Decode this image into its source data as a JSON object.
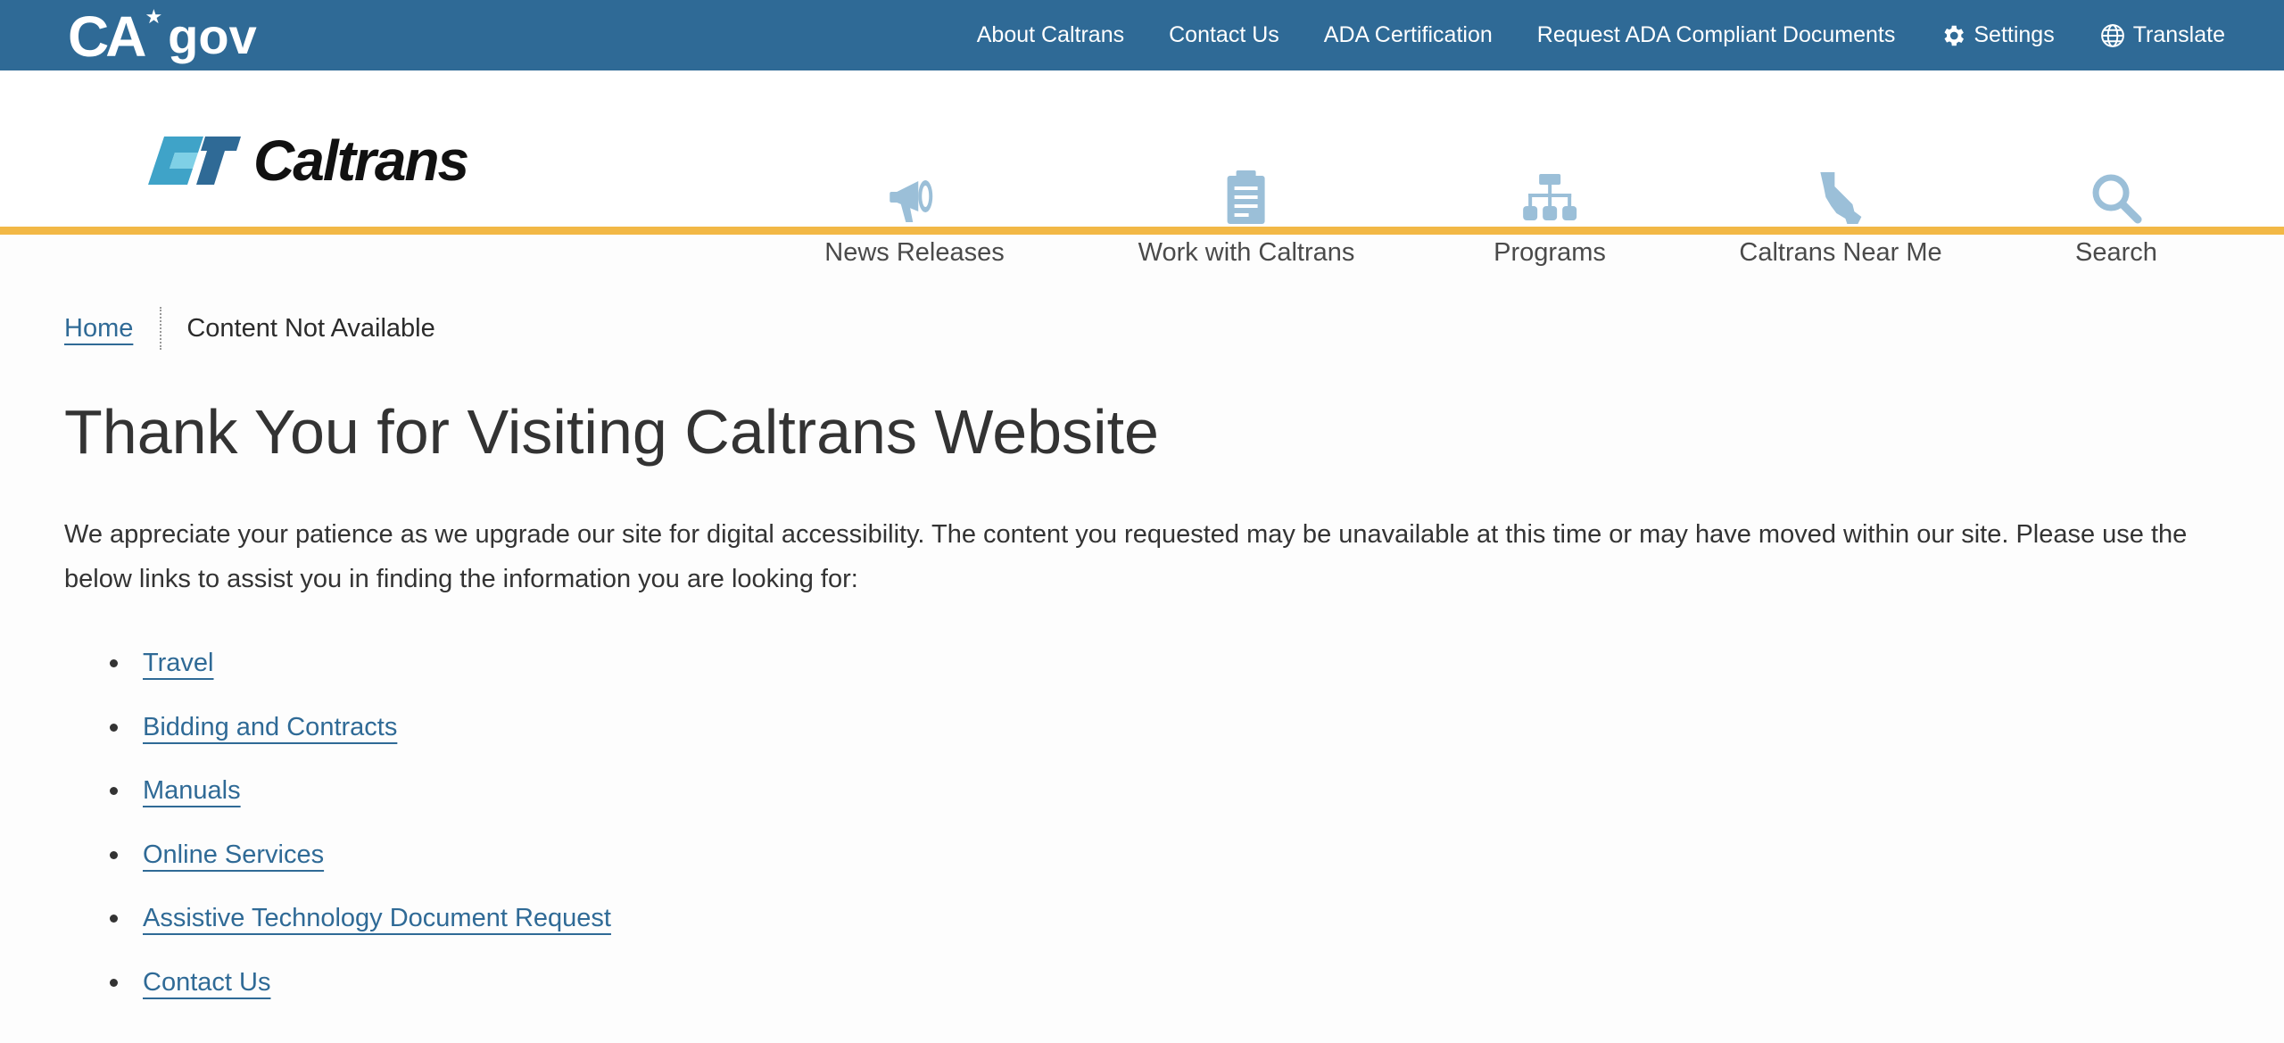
{
  "utility_bar": {
    "logo_text": "CA",
    "logo_gov": "gov",
    "links": [
      {
        "label": "About Caltrans"
      },
      {
        "label": "Contact Us"
      },
      {
        "label": "ADA Certification"
      },
      {
        "label": "Request ADA Compliant Documents"
      },
      {
        "label": "Settings",
        "icon": "gear-icon"
      },
      {
        "label": "Translate",
        "icon": "globe-icon"
      }
    ]
  },
  "header": {
    "logo_wordmark": "Caltrans",
    "nav": [
      {
        "label": "News Releases",
        "icon": "megaphone-icon"
      },
      {
        "label": "Work with Caltrans",
        "icon": "clipboard-icon"
      },
      {
        "label": "Programs",
        "icon": "org-chart-icon"
      },
      {
        "label": "Caltrans Near Me",
        "icon": "california-map-icon"
      },
      {
        "label": "Search",
        "icon": "search-icon"
      }
    ]
  },
  "breadcrumb": {
    "home": "Home",
    "current": "Content Not Available"
  },
  "main": {
    "title": "Thank You for Visiting Caltrans Website",
    "intro": "We appreciate your patience as we upgrade our site for digital accessibility. The content you requested may be unavailable at this time or may have moved within our site. Please use the below links to assist you in finding the information you are looking for:",
    "links": [
      {
        "label": "Travel"
      },
      {
        "label": "Bidding and Contracts"
      },
      {
        "label": "Manuals"
      },
      {
        "label": "Online Services"
      },
      {
        "label": "Assistive Technology Document Request"
      },
      {
        "label": "Contact Us"
      }
    ]
  },
  "colors": {
    "utility_bar": "#2f6a96",
    "accent_stripe": "#f2b846",
    "link": "#2f6a96",
    "nav_icon": "#9bbfd8"
  }
}
